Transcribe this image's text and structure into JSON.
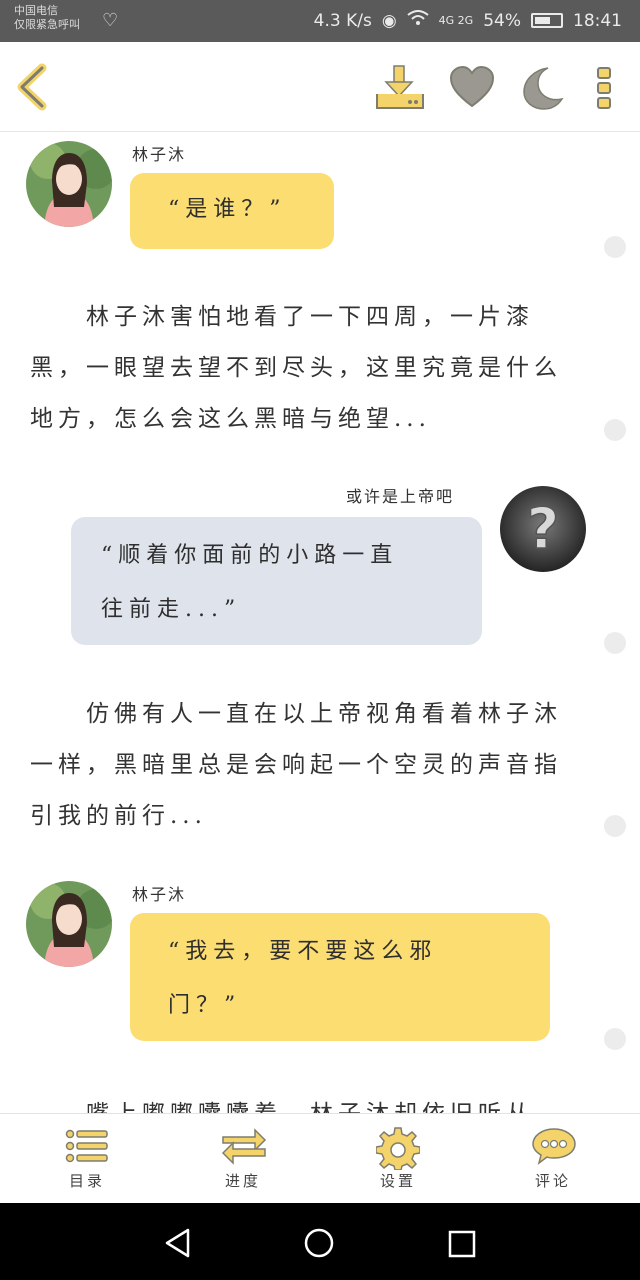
{
  "status_bar": {
    "carrier_line1": "中国电信",
    "carrier_line2": "仅限紧急呼叫",
    "net_speed": "4.3 K/s",
    "signal": "4G 2G",
    "battery": "54%",
    "battery_level": 0.54,
    "time": "18:41"
  },
  "toolbar": {
    "back_icon": "chevron-left-icon",
    "download_icon": "download-icon",
    "favorite_icon": "heart-icon",
    "night_icon": "moon-icon",
    "more_icon": "more-vertical-icon"
  },
  "messages": [
    {
      "type": "dialogue",
      "side": "left",
      "speaker": "林子沐",
      "text": "“是谁？”"
    },
    {
      "type": "narration",
      "text": "林子沐害怕地看了一下四周，一片漆黑，一眼望去望不到尽头，这里究竟是什么地方，怎么会这么黑暗与绝望..."
    },
    {
      "type": "dialogue",
      "side": "right",
      "speaker": "或许是上帝吧",
      "line1": "“顺着你面前的小路一直",
      "line2": "往前走...”"
    },
    {
      "type": "narration",
      "text": "仿佛有人一直在以上帝视角看着林子沐一样，黑暗里总是会响起一个空灵的声音指引我的前行..."
    },
    {
      "type": "dialogue",
      "side": "left",
      "speaker": "林子沐",
      "line1": "“我去，要不要这么邪",
      "line2": "门？”"
    },
    {
      "type": "narration",
      "text": "嘴上嘟嘟囔囔着，林子沐却依旧听从"
    }
  ],
  "bottom_nav": [
    {
      "label": "目录",
      "icon": "list-icon"
    },
    {
      "label": "进度",
      "icon": "swap-arrows-icon"
    },
    {
      "label": "设置",
      "icon": "gear-icon"
    },
    {
      "label": "评论",
      "icon": "comment-icon"
    }
  ],
  "colors": {
    "accent": "#f3d36a",
    "bubble_yellow": "#fbdd72",
    "bubble_gray": "#dfe4ec",
    "icon_gray": "#8a8a84"
  }
}
